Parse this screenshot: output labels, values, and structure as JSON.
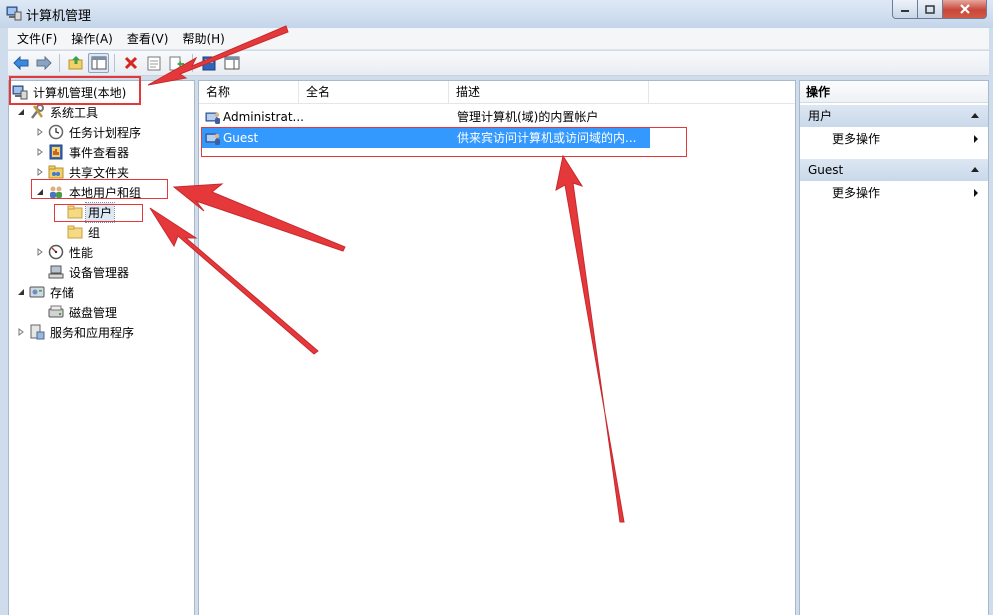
{
  "window": {
    "title": "计算机管理"
  },
  "menu": [
    {
      "label": "文件(F)"
    },
    {
      "label": "操作(A)"
    },
    {
      "label": "查看(V)"
    },
    {
      "label": "帮助(H)"
    }
  ],
  "tree": {
    "root": "计算机管理(本地)",
    "system_tools": "系统工具",
    "task_scheduler": "任务计划程序",
    "event_viewer": "事件查看器",
    "shared_folders": "共享文件夹",
    "local_users_groups": "本地用户和组",
    "users": "用户",
    "groups": "组",
    "performance": "性能",
    "device_manager": "设备管理器",
    "storage": "存储",
    "disk_management": "磁盘管理",
    "services_apps": "服务和应用程序"
  },
  "list": {
    "columns": [
      "名称",
      "全名",
      "描述"
    ],
    "rows": [
      {
        "name": "Administrat...",
        "fullname": "",
        "description": "管理计算机(域)的内置帐户"
      },
      {
        "name": "Guest",
        "fullname": "",
        "description": "供来宾访问计算机或访问域的内..."
      }
    ],
    "selected_row": 1
  },
  "actions": {
    "title": "操作",
    "sections": [
      {
        "header": "用户",
        "item": "更多操作"
      },
      {
        "header": "Guest",
        "item": "更多操作"
      }
    ]
  },
  "colors": {
    "selection": "#3399ff",
    "annotation": "#e23a3a"
  }
}
